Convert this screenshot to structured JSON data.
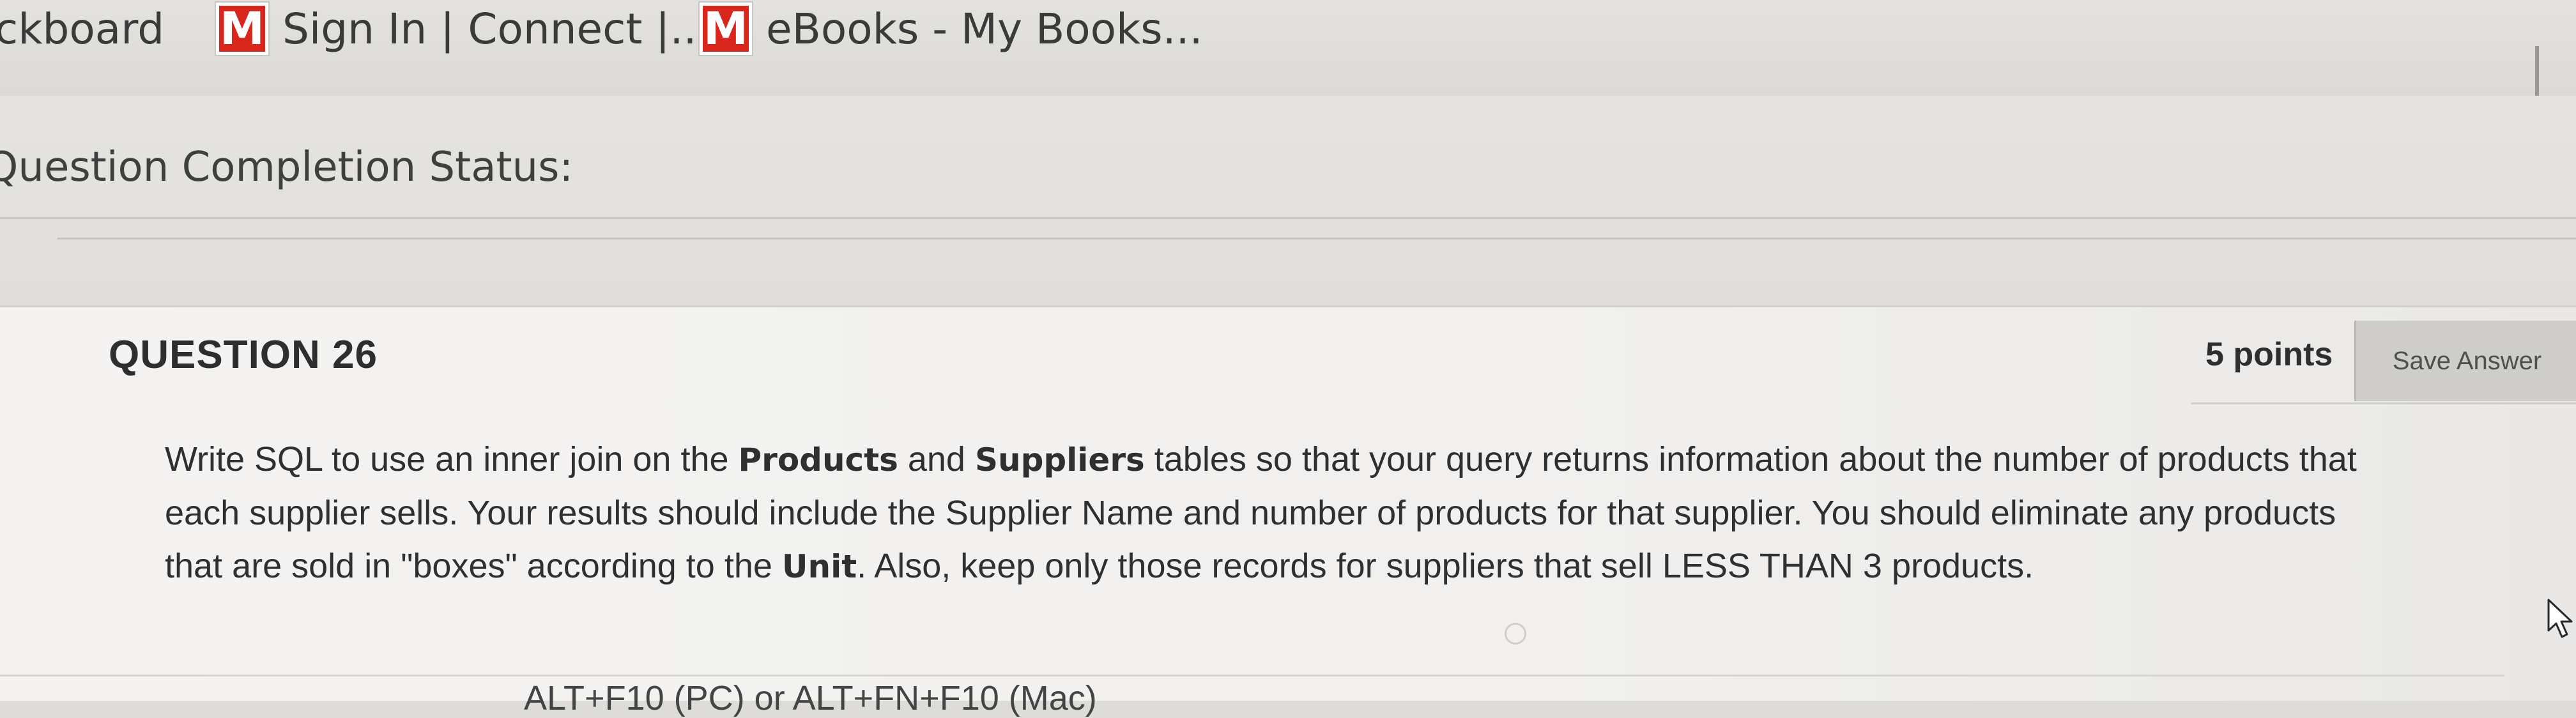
{
  "bookmarks": [
    {
      "label": "ckboard",
      "has_logo": false
    },
    {
      "label": "Sign In | Connect |...",
      "logo": "M"
    },
    {
      "label": "eBooks - My Books...",
      "logo": "M"
    }
  ],
  "status": {
    "label": "Question Completion Status:"
  },
  "question": {
    "title": "QUESTION 26",
    "points": "5 points",
    "save_label": "Save Answer",
    "lines": [
      {
        "pre": "Write SQL to use an inner join on the ",
        "b1": "Products",
        "mid": " and ",
        "b2": "Suppliers",
        "post": " tables so that your query returns information about the number of products that"
      },
      {
        "text": "each supplier sells. Your results should include the Supplier Name and number of products for that supplier.  You should eliminate any products"
      },
      {
        "pre": "that are sold in \"boxes\" according to the ",
        "b1": "Unit",
        "post": ".  Also, keep only those records for suppliers that sell  LESS THAN 3 products."
      }
    ]
  },
  "editor_hint": "ALT+F10 (PC) or ALT+FN+F10 (Mac)",
  "colors": {
    "logo_red": "#d9261c",
    "page_bg": "#f2f1ef",
    "button_bg": "#cfcdc9"
  },
  "icons": {
    "bookmark_logo": "mcgraw-hill-m-icon",
    "pointer": "mouse-pointer-icon"
  }
}
